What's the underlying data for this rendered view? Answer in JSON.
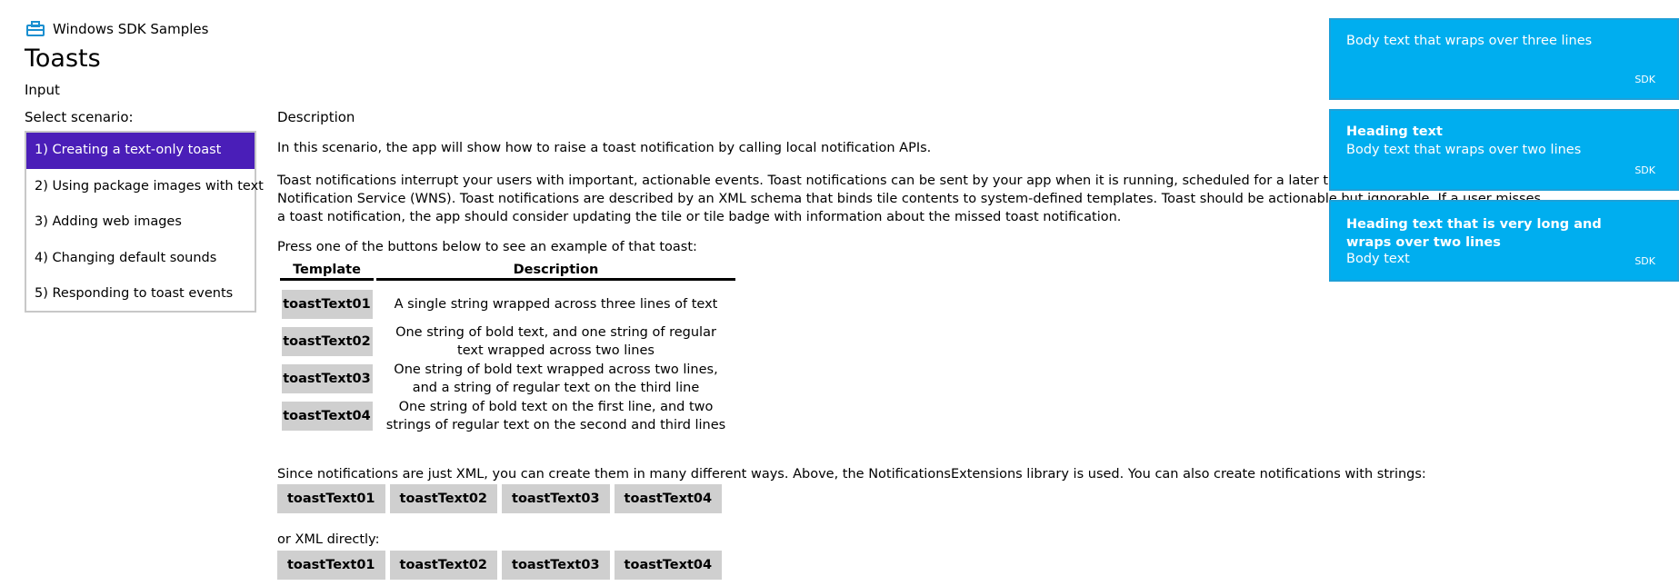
{
  "header": {
    "app_name": "Windows SDK Samples",
    "page_title": "Toasts",
    "input_label": "Input",
    "select_scenario_label": "Select scenario:"
  },
  "scenarios": [
    {
      "label": "1) Creating a text-only toast",
      "selected": true
    },
    {
      "label": "2) Using package images with text",
      "selected": false
    },
    {
      "label": "3) Adding web images",
      "selected": false
    },
    {
      "label": "4) Changing default sounds",
      "selected": false
    },
    {
      "label": "5) Responding to toast events",
      "selected": false
    }
  ],
  "description": {
    "heading": "Description",
    "p1": "In this scenario, the app will show how to raise a toast notification by calling local notification APIs.",
    "p2": "Toast notifications interrupt your users with important, actionable events. Toast notifications can be sent by your app when it is running, scheduled for a later time, or be sent by Windows Push Notification Service (WNS). Toast notifications are described by an XML schema that binds tile contents to system-defined templates. Toast should be actionable but ignorable. If a user misses a toast notification, the app should consider updating the tile or tile badge with information about the missed toast notification.",
    "press_text": "Press one of the buttons below to see an example of that toast:"
  },
  "template_table": {
    "headers": [
      "Template",
      "Description"
    ],
    "rows": [
      {
        "button": "toastText01",
        "description": "A single string wrapped across three lines of text"
      },
      {
        "button": "toastText02",
        "description": "One string of bold text, and one string of regular text wrapped across two lines"
      },
      {
        "button": "toastText03",
        "description": "One string of bold text wrapped across two lines, and a string of regular text on the third line"
      },
      {
        "button": "toastText04",
        "description": "One string of bold text on the first line, and two strings of regular text on the second and third lines"
      }
    ]
  },
  "strings_section": {
    "text": "Since notifications are just XML, you can create them in many different ways. Above, the NotificationsExtensions library is used. You can also create notifications with strings:",
    "buttons": [
      "toastText01",
      "toastText02",
      "toastText03",
      "toastText04"
    ]
  },
  "xml_section": {
    "text": "or XML directly:",
    "buttons": [
      "toastText01",
      "toastText02",
      "toastText03",
      "toastText04"
    ]
  },
  "toasts": [
    {
      "heading": "",
      "body": "Body text that wraps over three lines",
      "source": "SDK"
    },
    {
      "heading": "Heading text",
      "body": "Body text that wraps over two lines",
      "source": "SDK"
    },
    {
      "heading": "Heading text that is very long and wraps over two lines",
      "body": "Body text",
      "source": "SDK"
    }
  ],
  "colors": {
    "selected_scenario": "#4a1eb8",
    "toast_background": "#00aeef",
    "button_background": "#cfcfcf",
    "app_icon": "#1a8fd0"
  },
  "icons": {
    "app_icon": "toolbox-icon"
  }
}
